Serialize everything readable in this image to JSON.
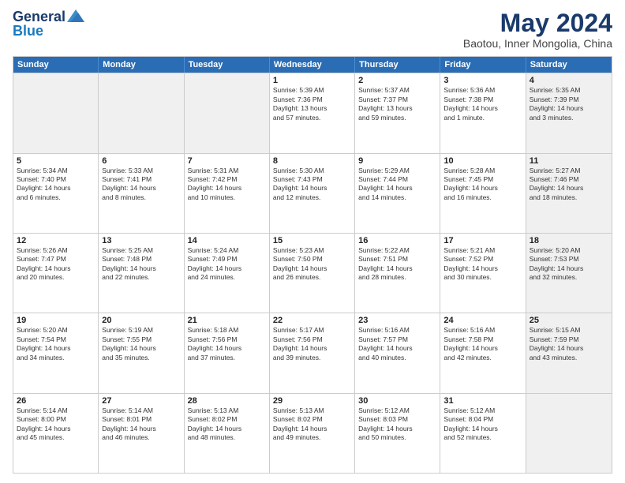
{
  "logo": {
    "line1": "General",
    "line2": "Blue"
  },
  "title": "May 2024",
  "subtitle": "Baotou, Inner Mongolia, China",
  "header_days": [
    "Sunday",
    "Monday",
    "Tuesday",
    "Wednesday",
    "Thursday",
    "Friday",
    "Saturday"
  ],
  "rows": [
    [
      {
        "day": "",
        "lines": [],
        "shade": true
      },
      {
        "day": "",
        "lines": [],
        "shade": true
      },
      {
        "day": "",
        "lines": [],
        "shade": true
      },
      {
        "day": "1",
        "lines": [
          "Sunrise: 5:39 AM",
          "Sunset: 7:36 PM",
          "Daylight: 13 hours",
          "and 57 minutes."
        ],
        "shade": false
      },
      {
        "day": "2",
        "lines": [
          "Sunrise: 5:37 AM",
          "Sunset: 7:37 PM",
          "Daylight: 13 hours",
          "and 59 minutes."
        ],
        "shade": false
      },
      {
        "day": "3",
        "lines": [
          "Sunrise: 5:36 AM",
          "Sunset: 7:38 PM",
          "Daylight: 14 hours",
          "and 1 minute."
        ],
        "shade": false
      },
      {
        "day": "4",
        "lines": [
          "Sunrise: 5:35 AM",
          "Sunset: 7:39 PM",
          "Daylight: 14 hours",
          "and 3 minutes."
        ],
        "shade": true
      }
    ],
    [
      {
        "day": "5",
        "lines": [
          "Sunrise: 5:34 AM",
          "Sunset: 7:40 PM",
          "Daylight: 14 hours",
          "and 6 minutes."
        ],
        "shade": false
      },
      {
        "day": "6",
        "lines": [
          "Sunrise: 5:33 AM",
          "Sunset: 7:41 PM",
          "Daylight: 14 hours",
          "and 8 minutes."
        ],
        "shade": false
      },
      {
        "day": "7",
        "lines": [
          "Sunrise: 5:31 AM",
          "Sunset: 7:42 PM",
          "Daylight: 14 hours",
          "and 10 minutes."
        ],
        "shade": false
      },
      {
        "day": "8",
        "lines": [
          "Sunrise: 5:30 AM",
          "Sunset: 7:43 PM",
          "Daylight: 14 hours",
          "and 12 minutes."
        ],
        "shade": false
      },
      {
        "day": "9",
        "lines": [
          "Sunrise: 5:29 AM",
          "Sunset: 7:44 PM",
          "Daylight: 14 hours",
          "and 14 minutes."
        ],
        "shade": false
      },
      {
        "day": "10",
        "lines": [
          "Sunrise: 5:28 AM",
          "Sunset: 7:45 PM",
          "Daylight: 14 hours",
          "and 16 minutes."
        ],
        "shade": false
      },
      {
        "day": "11",
        "lines": [
          "Sunrise: 5:27 AM",
          "Sunset: 7:46 PM",
          "Daylight: 14 hours",
          "and 18 minutes."
        ],
        "shade": true
      }
    ],
    [
      {
        "day": "12",
        "lines": [
          "Sunrise: 5:26 AM",
          "Sunset: 7:47 PM",
          "Daylight: 14 hours",
          "and 20 minutes."
        ],
        "shade": false
      },
      {
        "day": "13",
        "lines": [
          "Sunrise: 5:25 AM",
          "Sunset: 7:48 PM",
          "Daylight: 14 hours",
          "and 22 minutes."
        ],
        "shade": false
      },
      {
        "day": "14",
        "lines": [
          "Sunrise: 5:24 AM",
          "Sunset: 7:49 PM",
          "Daylight: 14 hours",
          "and 24 minutes."
        ],
        "shade": false
      },
      {
        "day": "15",
        "lines": [
          "Sunrise: 5:23 AM",
          "Sunset: 7:50 PM",
          "Daylight: 14 hours",
          "and 26 minutes."
        ],
        "shade": false
      },
      {
        "day": "16",
        "lines": [
          "Sunrise: 5:22 AM",
          "Sunset: 7:51 PM",
          "Daylight: 14 hours",
          "and 28 minutes."
        ],
        "shade": false
      },
      {
        "day": "17",
        "lines": [
          "Sunrise: 5:21 AM",
          "Sunset: 7:52 PM",
          "Daylight: 14 hours",
          "and 30 minutes."
        ],
        "shade": false
      },
      {
        "day": "18",
        "lines": [
          "Sunrise: 5:20 AM",
          "Sunset: 7:53 PM",
          "Daylight: 14 hours",
          "and 32 minutes."
        ],
        "shade": true
      }
    ],
    [
      {
        "day": "19",
        "lines": [
          "Sunrise: 5:20 AM",
          "Sunset: 7:54 PM",
          "Daylight: 14 hours",
          "and 34 minutes."
        ],
        "shade": false
      },
      {
        "day": "20",
        "lines": [
          "Sunrise: 5:19 AM",
          "Sunset: 7:55 PM",
          "Daylight: 14 hours",
          "and 35 minutes."
        ],
        "shade": false
      },
      {
        "day": "21",
        "lines": [
          "Sunrise: 5:18 AM",
          "Sunset: 7:56 PM",
          "Daylight: 14 hours",
          "and 37 minutes."
        ],
        "shade": false
      },
      {
        "day": "22",
        "lines": [
          "Sunrise: 5:17 AM",
          "Sunset: 7:56 PM",
          "Daylight: 14 hours",
          "and 39 minutes."
        ],
        "shade": false
      },
      {
        "day": "23",
        "lines": [
          "Sunrise: 5:16 AM",
          "Sunset: 7:57 PM",
          "Daylight: 14 hours",
          "and 40 minutes."
        ],
        "shade": false
      },
      {
        "day": "24",
        "lines": [
          "Sunrise: 5:16 AM",
          "Sunset: 7:58 PM",
          "Daylight: 14 hours",
          "and 42 minutes."
        ],
        "shade": false
      },
      {
        "day": "25",
        "lines": [
          "Sunrise: 5:15 AM",
          "Sunset: 7:59 PM",
          "Daylight: 14 hours",
          "and 43 minutes."
        ],
        "shade": true
      }
    ],
    [
      {
        "day": "26",
        "lines": [
          "Sunrise: 5:14 AM",
          "Sunset: 8:00 PM",
          "Daylight: 14 hours",
          "and 45 minutes."
        ],
        "shade": false
      },
      {
        "day": "27",
        "lines": [
          "Sunrise: 5:14 AM",
          "Sunset: 8:01 PM",
          "Daylight: 14 hours",
          "and 46 minutes."
        ],
        "shade": false
      },
      {
        "day": "28",
        "lines": [
          "Sunrise: 5:13 AM",
          "Sunset: 8:02 PM",
          "Daylight: 14 hours",
          "and 48 minutes."
        ],
        "shade": false
      },
      {
        "day": "29",
        "lines": [
          "Sunrise: 5:13 AM",
          "Sunset: 8:02 PM",
          "Daylight: 14 hours",
          "and 49 minutes."
        ],
        "shade": false
      },
      {
        "day": "30",
        "lines": [
          "Sunrise: 5:12 AM",
          "Sunset: 8:03 PM",
          "Daylight: 14 hours",
          "and 50 minutes."
        ],
        "shade": false
      },
      {
        "day": "31",
        "lines": [
          "Sunrise: 5:12 AM",
          "Sunset: 8:04 PM",
          "Daylight: 14 hours",
          "and 52 minutes."
        ],
        "shade": false
      },
      {
        "day": "",
        "lines": [],
        "shade": true
      }
    ]
  ]
}
